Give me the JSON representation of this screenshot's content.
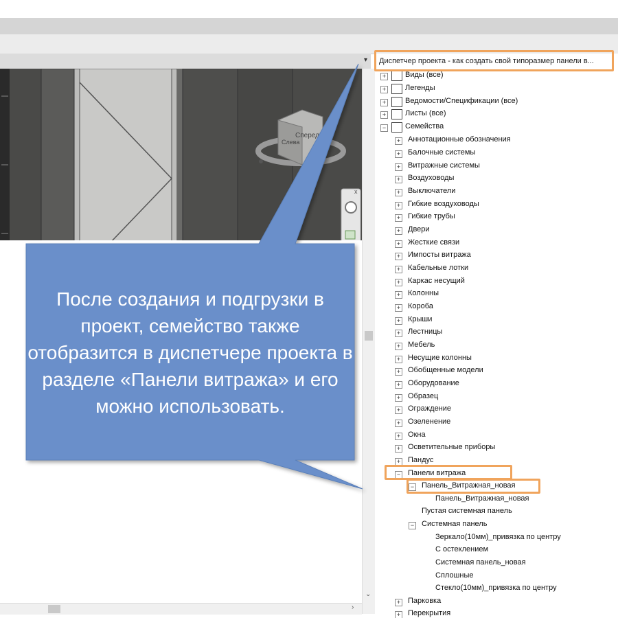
{
  "browser": {
    "title": "Диспетчер проекта - как создать свой типоразмер панели в..."
  },
  "tree": {
    "views": "Виды (все)",
    "legends": "Легенды",
    "schedules": "Ведомости/Спецификации (все)",
    "sheets": "Листы (все)",
    "families": "Семейства",
    "family_categories": [
      "Аннотационные обозначения",
      "Балочные системы",
      "Витражные системы",
      "Воздуховоды",
      "Выключатели",
      "Гибкие воздуховоды",
      "Гибкие трубы",
      "Двери",
      "Жесткие связи",
      "Импосты витража",
      "Кабельные лотки",
      "Каркас несущий",
      "Колонны",
      "Короба",
      "Крыши",
      "Лестницы",
      "Мебель",
      "Несущие колонны",
      "Обобщенные модели",
      "Оборудование",
      "Образец",
      "Ограждение",
      "Озеленение",
      "Окна",
      "Осветительные приборы",
      "Пандус"
    ],
    "curtain_panels": "Панели витража",
    "panel_family": "Панель_Витражная_новая",
    "panel_type": "Панель_Витражная_новая",
    "empty_panel": "Пустая системная панель",
    "system_panel": "Системная панель",
    "system_panel_types": [
      "Зеркало(10мм)_привязка по центру",
      "С остеклением",
      "Системная панель_новая",
      "Сплошные",
      "Стекло(10мм)_привязка по центру"
    ],
    "parking": "Парковка",
    "floors": "Перекрытия"
  },
  "viewcube": {
    "face_front": "Спереди",
    "face_side": "Слева"
  },
  "callout": {
    "text": "После создания и подгрузки в проект, семейство также отобразится в диспетчере проекта в разделе «Панели витража» и его можно использовать."
  },
  "colors": {
    "callout_fill": "#6a8fca",
    "highlight": "#f0a45c",
    "wall_dark": "#4a4a48"
  }
}
